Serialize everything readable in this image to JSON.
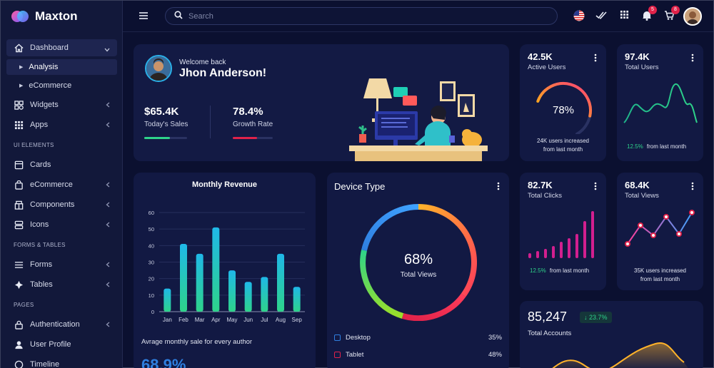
{
  "app": {
    "name": "Maxton"
  },
  "sidebar": {
    "items": [
      {
        "label": "Dashboard",
        "icon": "home-icon",
        "expanded": true
      },
      {
        "label": "Analysis",
        "sub": true,
        "active": true
      },
      {
        "label": "eCommerce",
        "sub": true
      },
      {
        "label": "Widgets",
        "icon": "widgets-icon"
      },
      {
        "label": "Apps",
        "icon": "apps-grid-icon"
      },
      {
        "section": "UI ELEMENTS"
      },
      {
        "label": "Cards",
        "icon": "cards-icon"
      },
      {
        "label": "eCommerce",
        "icon": "shopping-bag-icon"
      },
      {
        "label": "Components",
        "icon": "components-icon"
      },
      {
        "label": "Icons",
        "icon": "icons-icon"
      },
      {
        "section": "FORMS & TABLES"
      },
      {
        "label": "Forms",
        "icon": "forms-icon"
      },
      {
        "label": "Tables",
        "icon": "tables-icon"
      },
      {
        "section": "PAGES"
      },
      {
        "label": "Authentication",
        "icon": "lock-icon"
      },
      {
        "label": "User Profile",
        "icon": "user-icon"
      },
      {
        "label": "Timeline",
        "icon": "timeline-icon"
      }
    ]
  },
  "topbar": {
    "search_placeholder": "Search",
    "notifications_count": "5",
    "cart_count": "8"
  },
  "welcome": {
    "greeting": "Welcome back",
    "name": "Jhon Anderson!",
    "sales_value": "$65.4K",
    "sales_label": "Today's Sales",
    "sales_progress": 0.6,
    "growth_value": "78.4%",
    "growth_label": "Growth Rate",
    "growth_progress": 0.6
  },
  "active_users": {
    "value": "42.5K",
    "label": "Active Users",
    "gauge_percent": "78%",
    "gauge_fraction": 0.78,
    "footer_line1": "24K users increased",
    "footer_line2": "from last month"
  },
  "total_users": {
    "value": "97.4K",
    "label": "Total Users",
    "change": "12.5%",
    "change_text": "from last month"
  },
  "total_clicks": {
    "value": "82.7K",
    "label": "Total Clicks",
    "change": "12.5%",
    "change_text": "from last month"
  },
  "total_views": {
    "value": "68.4K",
    "label": "Total Views",
    "footer_line1": "35K users increased",
    "footer_line2": "from last month"
  },
  "device_type": {
    "title": "Device Type",
    "center_value": "68%",
    "center_label": "Total Views",
    "rows": [
      {
        "label": "Desktop",
        "percent": "35%",
        "color": "#2f7fe0"
      },
      {
        "label": "Tablet",
        "percent": "48%",
        "color": "#e0224a"
      }
    ]
  },
  "total_accounts": {
    "value": "85,247",
    "change": "23.7%",
    "label": "Total Accounts"
  },
  "monthly_revenue": {
    "title": "Monthly Revenue",
    "footer": "Avrage monthly sale for every author",
    "footer_value": "68.9%"
  },
  "chart_data": {
    "type": "bar",
    "title": "Monthly Revenue",
    "categories": [
      "Jan",
      "Feb",
      "Mar",
      "Apr",
      "May",
      "Jun",
      "Jul",
      "Aug",
      "Sep"
    ],
    "values": [
      14,
      41,
      35,
      51,
      25,
      18,
      21,
      35,
      15
    ],
    "ylim": [
      0,
      60
    ],
    "yticks": [
      0,
      10,
      20,
      30,
      40,
      50,
      60
    ],
    "grid": true
  },
  "colors": {
    "accent_green": "#2ed38a",
    "accent_pink": "#e0224a",
    "card_bg": "#121943"
  }
}
